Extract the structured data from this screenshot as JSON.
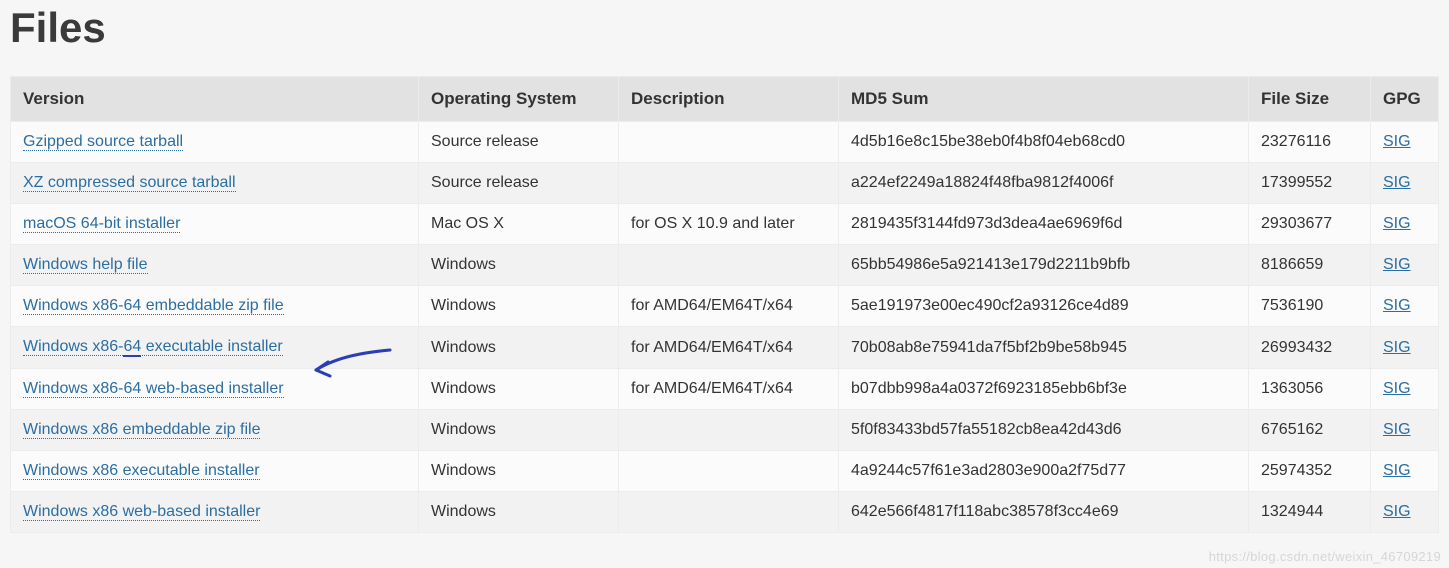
{
  "title": "Files",
  "columns": {
    "version": "Version",
    "os": "Operating System",
    "desc": "Description",
    "md5": "MD5 Sum",
    "size": "File Size",
    "gpg": "GPG"
  },
  "sig_label": "SIG",
  "rows": [
    {
      "version": "Gzipped source tarball",
      "os": "Source release",
      "desc": "",
      "md5": "4d5b16e8c15be38eb0f4b8f04eb68cd0",
      "size": "23276116"
    },
    {
      "version": "XZ compressed source tarball",
      "os": "Source release",
      "desc": "",
      "md5": "a224ef2249a18824f48fba9812f4006f",
      "size": "17399552"
    },
    {
      "version": "macOS 64-bit installer",
      "os": "Mac OS X",
      "desc": "for OS X 10.9 and later",
      "md5": "2819435f3144fd973d3dea4ae6969f6d",
      "size": "29303677"
    },
    {
      "version": "Windows help file",
      "os": "Windows",
      "desc": "",
      "md5": "65bb54986e5a921413e179d2211b9bfb",
      "size": "8186659"
    },
    {
      "version": "Windows x86-64 embeddable zip file",
      "os": "Windows",
      "desc": "for AMD64/EM64T/x64",
      "md5": "5ae191973e00ec490cf2a93126ce4d89",
      "size": "7536190"
    },
    {
      "version": "Windows x86-64 executable installer",
      "os": "Windows",
      "desc": "for AMD64/EM64T/x64",
      "md5": "70b08ab8e75941da7f5bf2b9be58b945",
      "size": "26993432"
    },
    {
      "version": "Windows x86-64 web-based installer",
      "os": "Windows",
      "desc": "for AMD64/EM64T/x64",
      "md5": "b07dbb998a4a0372f6923185ebb6bf3e",
      "size": "1363056"
    },
    {
      "version": "Windows x86 embeddable zip file",
      "os": "Windows",
      "desc": "",
      "md5": "5f0f83433bd57fa55182cb8ea42d43d6",
      "size": "6765162"
    },
    {
      "version": "Windows x86 executable installer",
      "os": "Windows",
      "desc": "",
      "md5": "4a9244c57f61e3ad2803e900a2f75d77",
      "size": "25974352"
    },
    {
      "version": "Windows x86 web-based installer",
      "os": "Windows",
      "desc": "",
      "md5": "642e566f4817f118abc38578f3cc4e69",
      "size": "1324944"
    }
  ],
  "annotation": {
    "highlight_row_index": 5
  },
  "watermark": "https://blog.csdn.net/weixin_46709219"
}
